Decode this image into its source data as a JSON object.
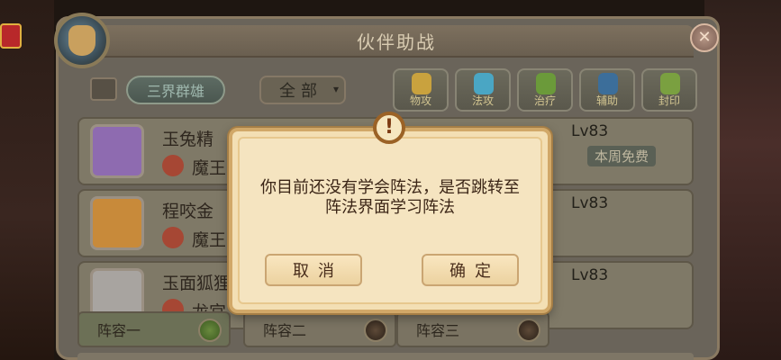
{
  "title": "伙伴助战",
  "realm_tab": "三界群雄",
  "filter": {
    "selected": "全部",
    "arrow": "▾"
  },
  "type_buttons": [
    {
      "label": "物攻",
      "icon": "sword-icon",
      "color": "#c9a23e"
    },
    {
      "label": "法攻",
      "icon": "crystal-icon",
      "color": "#4aa6c4"
    },
    {
      "label": "治疗",
      "icon": "leaf-icon",
      "color": "#6b9a3a"
    },
    {
      "label": "辅助",
      "icon": "book-icon",
      "color": "#3c6e9a"
    },
    {
      "label": "封印",
      "icon": "seal-icon",
      "color": "#7aa040"
    }
  ],
  "partners": [
    {
      "name": "玉兔精",
      "faction": "魔王",
      "level": "Lv83",
      "badge": "本周免费",
      "portrait_color": "#8e6bb0"
    },
    {
      "name": "程咬金",
      "faction": "魔王",
      "level": "Lv83",
      "badge": "",
      "portrait_color": "#c88a3a"
    },
    {
      "name": "玉面狐狸",
      "faction": "龙宫",
      "level": "Lv83",
      "badge": "",
      "portrait_color": "#a8a4a0"
    }
  ],
  "lineups": [
    {
      "label": "阵容一"
    },
    {
      "label": "阵容二"
    },
    {
      "label": "阵容三"
    }
  ],
  "dialog": {
    "alert_symbol": "!",
    "message_line1": "你目前还没有学会阵法，是否跳转至",
    "message_line2": "阵法界面学习阵法",
    "cancel_label": "取消",
    "confirm_label": "确定"
  },
  "colors": {
    "dialog_bg": "#f3dfb4",
    "dialog_border": "#d1a868",
    "panel_bg": "#6b6458"
  }
}
